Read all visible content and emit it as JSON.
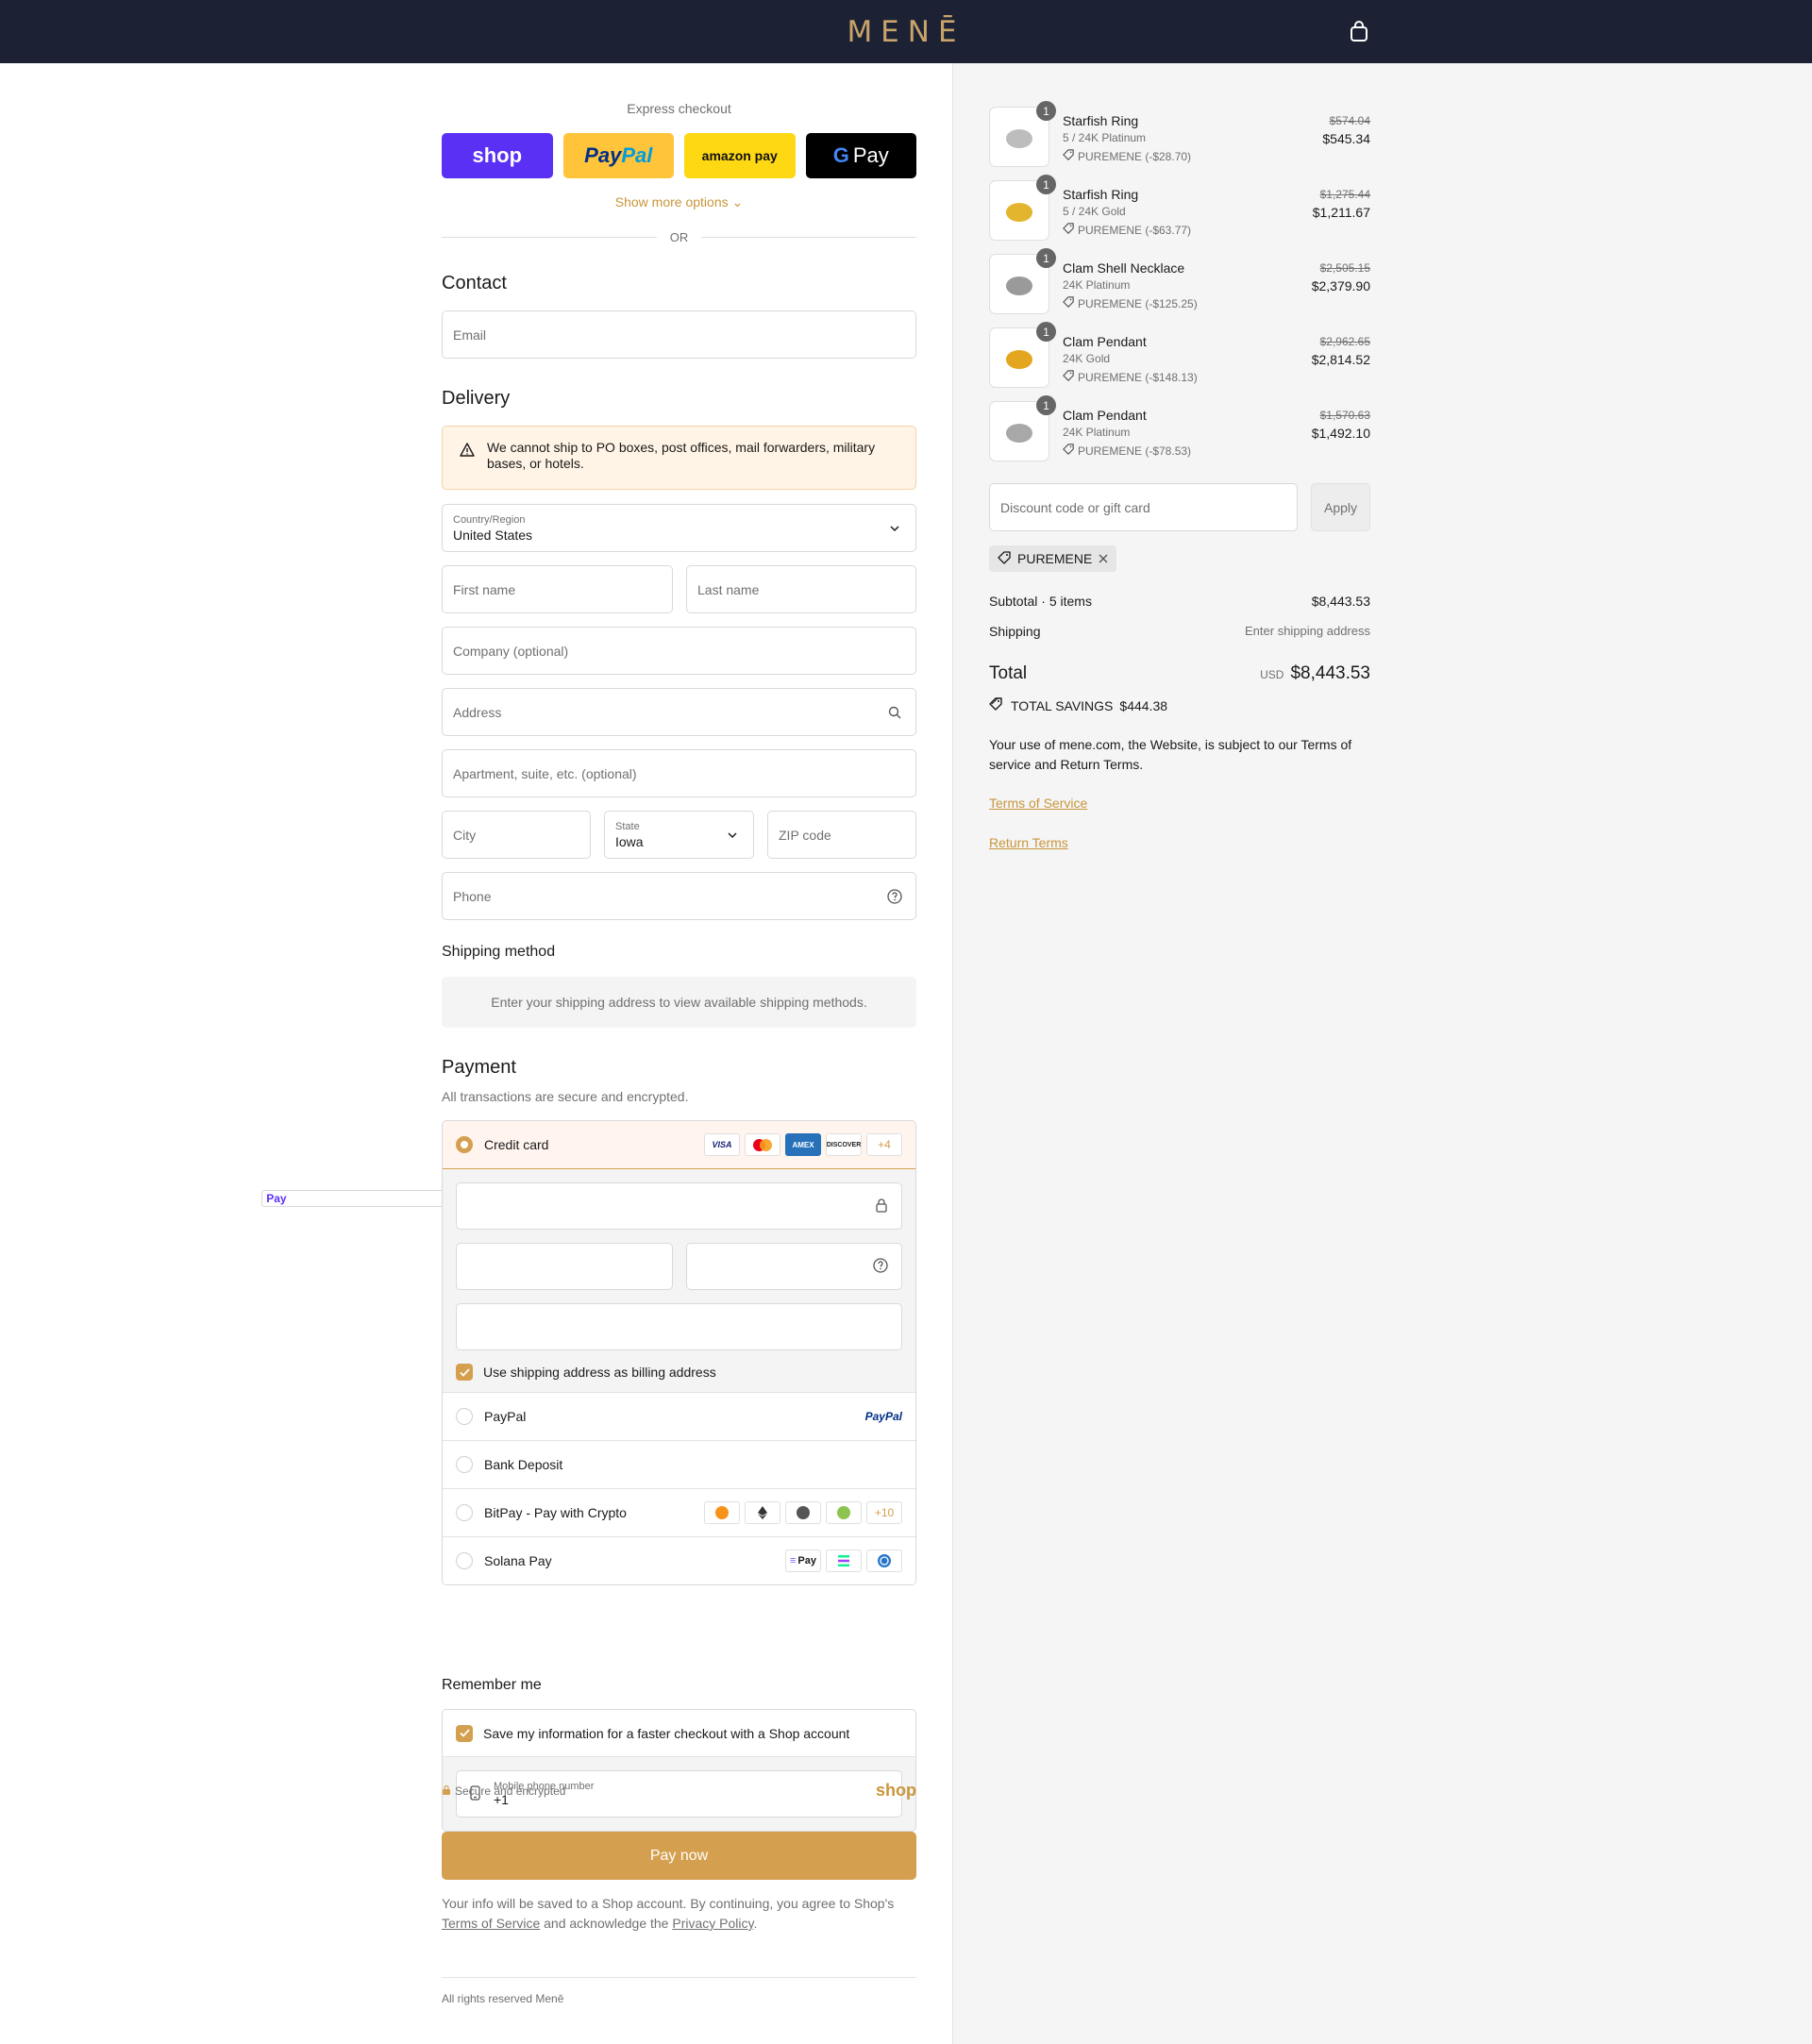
{
  "header": {
    "brand": "MENĒ",
    "cart_icon": "bag-icon"
  },
  "express": {
    "title": "Express checkout",
    "buttons": {
      "shop": "shop",
      "shop_pay": "Pay",
      "paypal_a": "Pay",
      "paypal_b": "Pal",
      "amazon": "amazon pay",
      "gpay_g": "G",
      "gpay": "Pay"
    },
    "more": "Show more options",
    "or": "OR"
  },
  "contact": {
    "heading": "Contact",
    "email_placeholder": "Email"
  },
  "delivery": {
    "heading": "Delivery",
    "notice": "We cannot ship to PO boxes, post offices, mail forwarders, military bases, or hotels.",
    "country_label": "Country/Region",
    "country_value": "United States",
    "first_name": "First name",
    "last_name": "Last name",
    "company": "Company (optional)",
    "address": "Address",
    "apartment": "Apartment, suite, etc. (optional)",
    "city": "City",
    "state_label": "State",
    "state_value": "Iowa",
    "zip": "ZIP code",
    "phone": "Phone"
  },
  "shipping_method": {
    "heading": "Shipping method",
    "empty": "Enter your shipping address to view available shipping methods."
  },
  "payment": {
    "heading": "Payment",
    "subtitle": "All transactions are secure and encrypted.",
    "credit_card": "Credit card",
    "card_brands": [
      "VISA",
      "MC",
      "AMEX",
      "DISCOVER"
    ],
    "card_more": "+4",
    "billing_same": "Use shipping address as billing address",
    "paypal": "PayPal",
    "paypal_logo": "PayPal",
    "bank": "Bank Deposit",
    "bitpay": "BitPay - Pay with Crypto",
    "crypto_more": "+10",
    "solana": "Solana Pay",
    "solana_pay": "Pay"
  },
  "remember": {
    "heading": "Remember me",
    "save": "Save my information for a faster checkout with a Shop account",
    "mobile_label": "Mobile phone number",
    "mobile_value": "+1",
    "secure": "Secure and encrypted",
    "shop": "shop"
  },
  "pay_now": "Pay now",
  "consent": {
    "text1": "Your info will be saved to a Shop account. By continuing, you agree to Shop's ",
    "terms": "Terms of Service",
    "text2": " and acknowledge the ",
    "privacy": "Privacy Policy",
    "text3": "."
  },
  "footer": "All rights reserved Menē",
  "summary": {
    "items": [
      {
        "name": "Starfish Ring",
        "variant": "5 / 24K Platinum",
        "discount": "PUREMENE (-$28.70)",
        "original": "$574.04",
        "price": "$545.34",
        "qty": "1",
        "color": "#bdbdbd"
      },
      {
        "name": "Starfish Ring",
        "variant": "5 / 24K Gold",
        "discount": "PUREMENE (-$63.77)",
        "original": "$1,275.44",
        "price": "$1,211.67",
        "qty": "1",
        "color": "#e3b52e"
      },
      {
        "name": "Clam Shell Necklace",
        "variant": "24K Platinum",
        "discount": "PUREMENE (-$125.25)",
        "original": "$2,505.15",
        "price": "$2,379.90",
        "qty": "1",
        "color": "#9a9a9a"
      },
      {
        "name": "Clam Pendant",
        "variant": "24K Gold",
        "discount": "PUREMENE (-$148.13)",
        "original": "$2,962.65",
        "price": "$2,814.52",
        "qty": "1",
        "color": "#e3a61e"
      },
      {
        "name": "Clam Pendant",
        "variant": "24K Platinum",
        "discount": "PUREMENE (-$78.53)",
        "original": "$1,570.63",
        "price": "$1,492.10",
        "qty": "1",
        "color": "#a8a8a8"
      }
    ],
    "discount_placeholder": "Discount code or gift card",
    "apply": "Apply",
    "code": "PUREMENE",
    "subtotal_label": "Subtotal · 5 items",
    "subtotal": "$8,443.53",
    "shipping_label": "Shipping",
    "shipping_value": "Enter shipping address",
    "total_label": "Total",
    "currency": "USD",
    "total": "$8,443.53",
    "savings_label": "TOTAL SAVINGS",
    "savings": "$444.38",
    "terms_text": "Your use of mene.com, the Website, is subject to our Terms of service and Return Terms.",
    "tos_link": "Terms of Service",
    "return_link": "Return Terms"
  }
}
